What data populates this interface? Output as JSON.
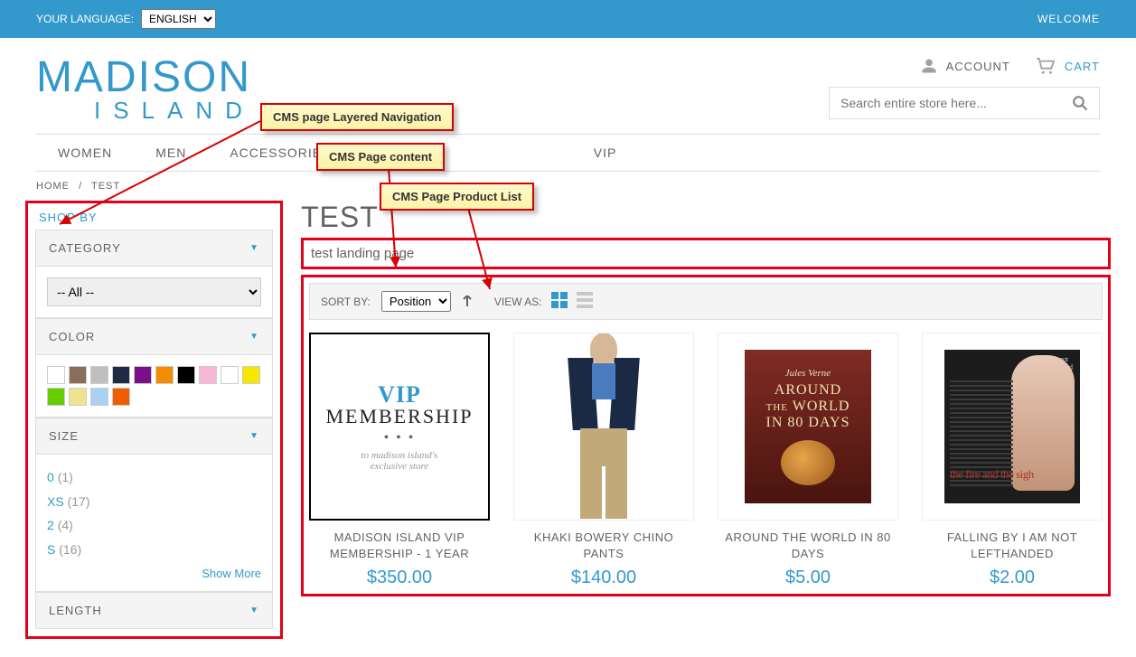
{
  "topbar": {
    "language_label": "YOUR LANGUAGE:",
    "language_value": "ENGLISH",
    "welcome": "WELCOME"
  },
  "header": {
    "logo_line1": "MADISON",
    "logo_line2": "ISLAND",
    "account_label": "ACCOUNT",
    "cart_label": "CART",
    "search_placeholder": "Search entire store here..."
  },
  "nav": {
    "items": [
      "WOMEN",
      "MEN",
      "ACCESSORIES",
      "",
      "",
      "VIP"
    ]
  },
  "breadcrumb": {
    "home": "HOME",
    "sep": "/",
    "current": "TEST"
  },
  "sidebar": {
    "shop_by": "SHOP BY",
    "facets": {
      "category": {
        "label": "CATEGORY",
        "selected": "-- All --"
      },
      "color": {
        "label": "COLOR",
        "swatches": [
          "#ffffff",
          "#8b6d5c",
          "#bfbfbf",
          "#1f2a44",
          "#7a0f8a",
          "#f28c00",
          "#000000",
          "#f7b8d6",
          "#ffffff",
          "#f7e600",
          "#66cc00",
          "#efe38e",
          "#a7d3f2",
          "#f25c00"
        ]
      },
      "size": {
        "label": "SIZE",
        "options": [
          {
            "lbl": "0",
            "cnt": "(1)"
          },
          {
            "lbl": "XS",
            "cnt": "(17)"
          },
          {
            "lbl": "2",
            "cnt": "(4)"
          },
          {
            "lbl": "S",
            "cnt": "(16)"
          }
        ],
        "show_more": "Show More"
      },
      "length": {
        "label": "LENGTH"
      }
    }
  },
  "content": {
    "page_title": "TEST",
    "cms_text": "test landing page",
    "toolbar": {
      "sort_by_label": "SORT BY:",
      "sort_by_value": "Position",
      "view_as_label": "VIEW AS:"
    },
    "products": [
      {
        "name": "MADISON ISLAND VIP MEMBERSHIP - 1 YEAR",
        "price": "$350.00"
      },
      {
        "name": "KHAKI BOWERY CHINO PANTS",
        "price": "$140.00"
      },
      {
        "name": "AROUND THE WORLD IN 80 DAYS",
        "price": "$5.00"
      },
      {
        "name": "FALLING BY I AM NOT LEFTHANDED",
        "price": "$2.00"
      }
    ]
  },
  "annot": {
    "a1": "CMS page Layered Navigation",
    "a2": "CMS Page content",
    "a3": "CMS Page Product List"
  }
}
